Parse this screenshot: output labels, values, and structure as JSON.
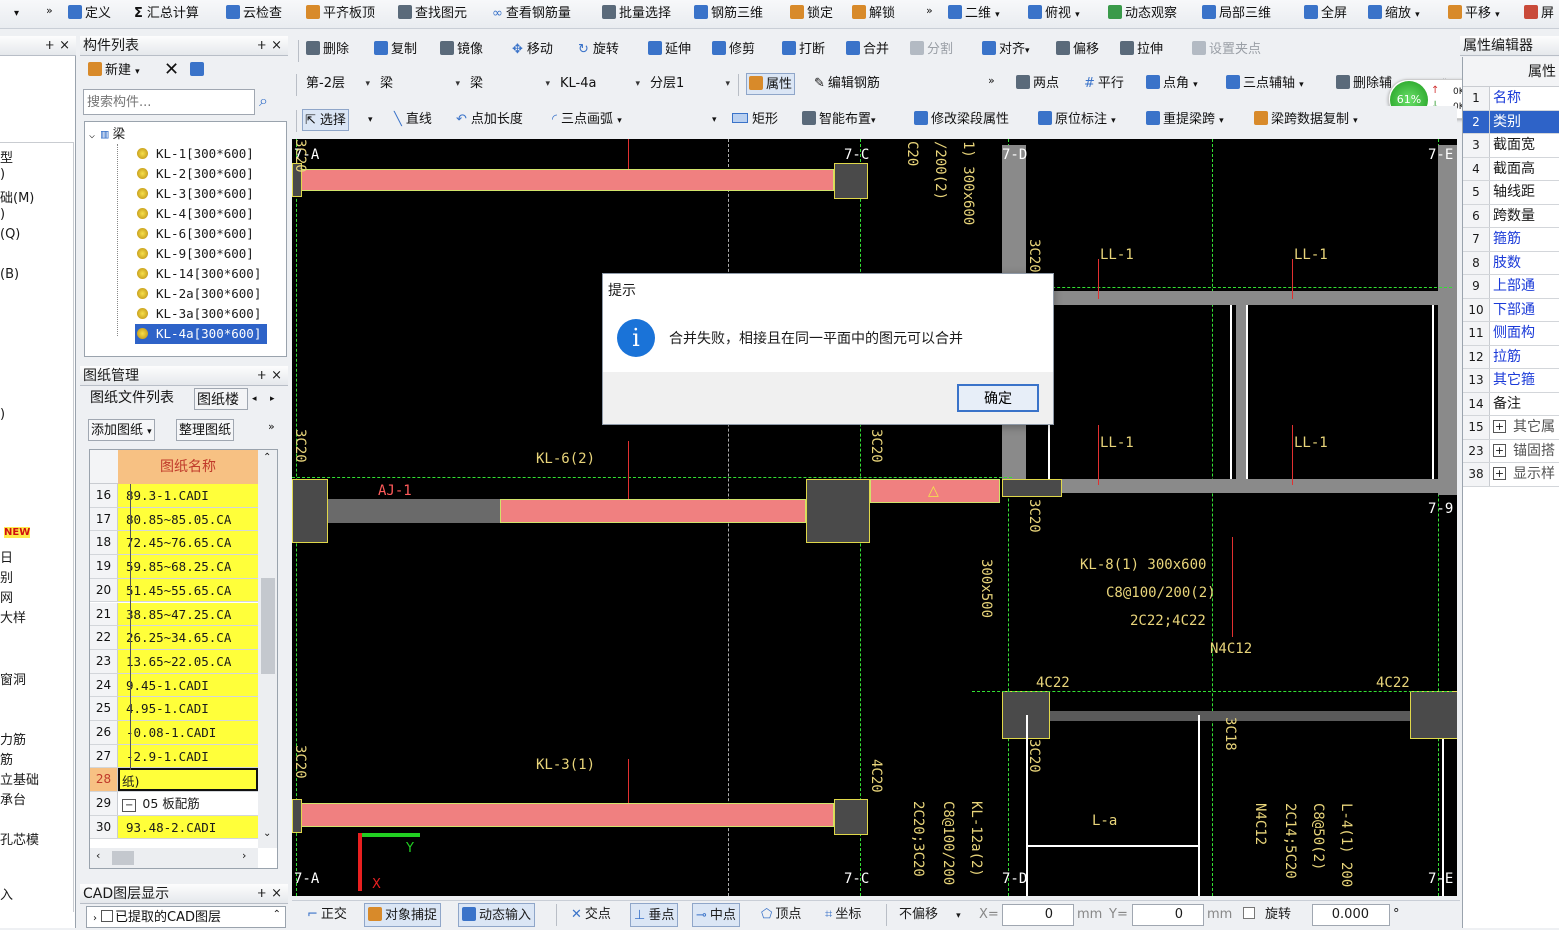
{
  "top_toolbar": {
    "items": [
      "定义",
      "汇总计算",
      "云检查",
      "平齐板顶",
      "查找图元",
      "查看钢筋量",
      "批量选择",
      "钢筋三维",
      "锁定",
      "解锁",
      "二维",
      "俯视",
      "动态观察",
      "局部三维",
      "全屏",
      "缩放",
      "平移",
      "屏"
    ]
  },
  "edit_toolbar": {
    "items": [
      "删除",
      "复制",
      "镜像",
      "移动",
      "旋转",
      "延伸",
      "修剪",
      "打断",
      "合并",
      "分割",
      "对齐",
      "偏移",
      "拉伸",
      "设置夹点"
    ]
  },
  "selector_bar": {
    "floor": "第-2层",
    "type1": "梁",
    "type2": "梁",
    "component": "KL-4a",
    "layer": "分层1",
    "attr_button": "属性",
    "edit_rebar": "编辑钢筋",
    "two_point": "两点",
    "parallel": "平行",
    "point_angle": "点角",
    "three_point_axis": "三点辅轴",
    "delete_aux": "删除辅"
  },
  "draw_bar": {
    "select": "选择",
    "line": "直线",
    "point_add_length": "点加长度",
    "three_point_arc": "三点画弧",
    "rect": "矩形",
    "smart_layout": "智能布置",
    "modify_span_attr": "修改梁段属性",
    "original_mark": "原位标注",
    "re_extract_span": "重提梁跨",
    "span_data_copy": "梁跨数据复制"
  },
  "network": {
    "percent": "61%",
    "up": "0K/s",
    "down": "0K/s"
  },
  "left_edge": {
    "items": [
      "型",
      ")",
      "础(M)",
      ")",
      "(Q)",
      "(B)",
      ")",
      "NEW",
      "日",
      "别",
      "网",
      "大样",
      "窗洞",
      "力筋",
      "筋",
      "立基础",
      "承台",
      "孔芯模",
      "入"
    ]
  },
  "component_list": {
    "title": "构件列表",
    "new_label": "新建",
    "search_placeholder": "搜索构件...",
    "root": "梁",
    "items": [
      "KL-1[300*600]",
      "KL-2[300*600]",
      "KL-3[300*600]",
      "KL-4[300*600]",
      "KL-6[300*600]",
      "KL-9[300*600]",
      "KL-14[300*600]",
      "KL-2a[300*600]",
      "KL-3a[300*600]",
      "KL-4a[300*600]"
    ]
  },
  "drawing_mgmt": {
    "title": "图纸管理",
    "tab1": "图纸文件列表",
    "tab2": "图纸楼",
    "add": "添加图纸",
    "organize": "整理图纸",
    "col_header": "图纸名称",
    "rows": [
      {
        "n": "16",
        "v": "89.3-1.CADI"
      },
      {
        "n": "17",
        "v": "80.85~85.05.CA"
      },
      {
        "n": "18",
        "v": "72.45~76.65.CA"
      },
      {
        "n": "19",
        "v": "59.85~68.25.CA"
      },
      {
        "n": "20",
        "v": "51.45~55.65.CA"
      },
      {
        "n": "21",
        "v": "38.85~47.25.CA"
      },
      {
        "n": "22",
        "v": "26.25~34.65.CA"
      },
      {
        "n": "23",
        "v": "13.65~22.05.CA"
      },
      {
        "n": "24",
        "v": "9.45-1.CADI"
      },
      {
        "n": "25",
        "v": "4.95-1.CADI"
      },
      {
        "n": "26",
        "v": "-0.08-1.CADI"
      },
      {
        "n": "27",
        "v": "-2.9-1.CADI"
      },
      {
        "n": "28",
        "v": "纸)"
      },
      {
        "n": "29",
        "v": "05 板配筋"
      },
      {
        "n": "30",
        "v": "93.48-2.CADI"
      }
    ]
  },
  "cad_layer": {
    "title": "CAD图层显示",
    "item": "已提取的CAD图层"
  },
  "canvas": {
    "axes": [
      "7-A",
      "7-C",
      "7-D",
      "7-E",
      "7-9",
      "7-A",
      "7-C",
      "7-D",
      "7-E"
    ],
    "labels": {
      "kl6": "KL-6(2)",
      "kl3": "KL-3(1)",
      "aj": "AJ-1",
      "ll1a": "LL-1",
      "ll1b": "LL-1",
      "ll1c": "LL-1",
      "ll1d": "LL-1",
      "kl8": "KL-8(1) 300x600",
      "kl8b": "C8@100/200(2)",
      "kl8c": "2C22;4C22",
      "kl8d": "N4C12",
      "c4a": "4C22",
      "c4b": "4C22",
      "la": "L-a",
      "v1": "C20",
      "v2": "/200(2)",
      "v3": "1) 300x600",
      "v4": "3C20",
      "v5": "3C20",
      "v6": "3C20",
      "v7": "300x500",
      "v8": "4C20",
      "v9": "3C20",
      "v10": "2C20;3C20",
      "v11": "C8@100/200",
      "v12": "KL-12a(2)",
      "v13": "3C20",
      "v14": "3C18",
      "v15": "N4C12",
      "v16": "2C14;5C20",
      "v17": "C8@50(2)",
      "v18": "L-4(1) 200",
      "v19": "3C20",
      "v20": "3C20",
      "ylabel": "Y",
      "xlabel": "X"
    }
  },
  "dialog": {
    "title": "提示",
    "message": "合并失败，相接且在同一平面中的图元可以合并",
    "ok": "确定",
    "info_glyph": "i"
  },
  "property_editor": {
    "title": "属性编辑器",
    "header": "属性",
    "rows": [
      {
        "n": "1",
        "v": "名称"
      },
      {
        "n": "2",
        "v": "类别"
      },
      {
        "n": "3",
        "v": "截面宽"
      },
      {
        "n": "4",
        "v": "截面高"
      },
      {
        "n": "5",
        "v": "轴线距"
      },
      {
        "n": "6",
        "v": "跨数量"
      },
      {
        "n": "7",
        "v": "箍筋"
      },
      {
        "n": "8",
        "v": "肢数"
      },
      {
        "n": "9",
        "v": "上部通"
      },
      {
        "n": "10",
        "v": "下部通"
      },
      {
        "n": "11",
        "v": "侧面构"
      },
      {
        "n": "12",
        "v": "拉筋"
      },
      {
        "n": "13",
        "v": "其它箍"
      },
      {
        "n": "14",
        "v": "备注"
      },
      {
        "n": "15",
        "v": "其它属"
      },
      {
        "n": "23",
        "v": "锚固搭"
      },
      {
        "n": "38",
        "v": "显示样"
      }
    ]
  },
  "status_bar": {
    "ortho": "正交",
    "snap": "对象捕捉",
    "dyn_input": "动态输入",
    "intersection": "交点",
    "perp": "垂点",
    "midpoint": "中点",
    "vertex": "顶点",
    "coord": "坐标",
    "no_offset": "不偏移",
    "x_label": "X=",
    "x_val": "0",
    "mm1": "mm",
    "y_label": "Y=",
    "y_val": "0",
    "mm2": "mm",
    "rotate": "旋转",
    "rot_val": "0.000",
    "deg": "°"
  },
  "colors": {
    "beam": "#f08080",
    "column": "#4a4a4a",
    "dialog_info": "#1a73d8",
    "highlight": "#ffff3a"
  }
}
